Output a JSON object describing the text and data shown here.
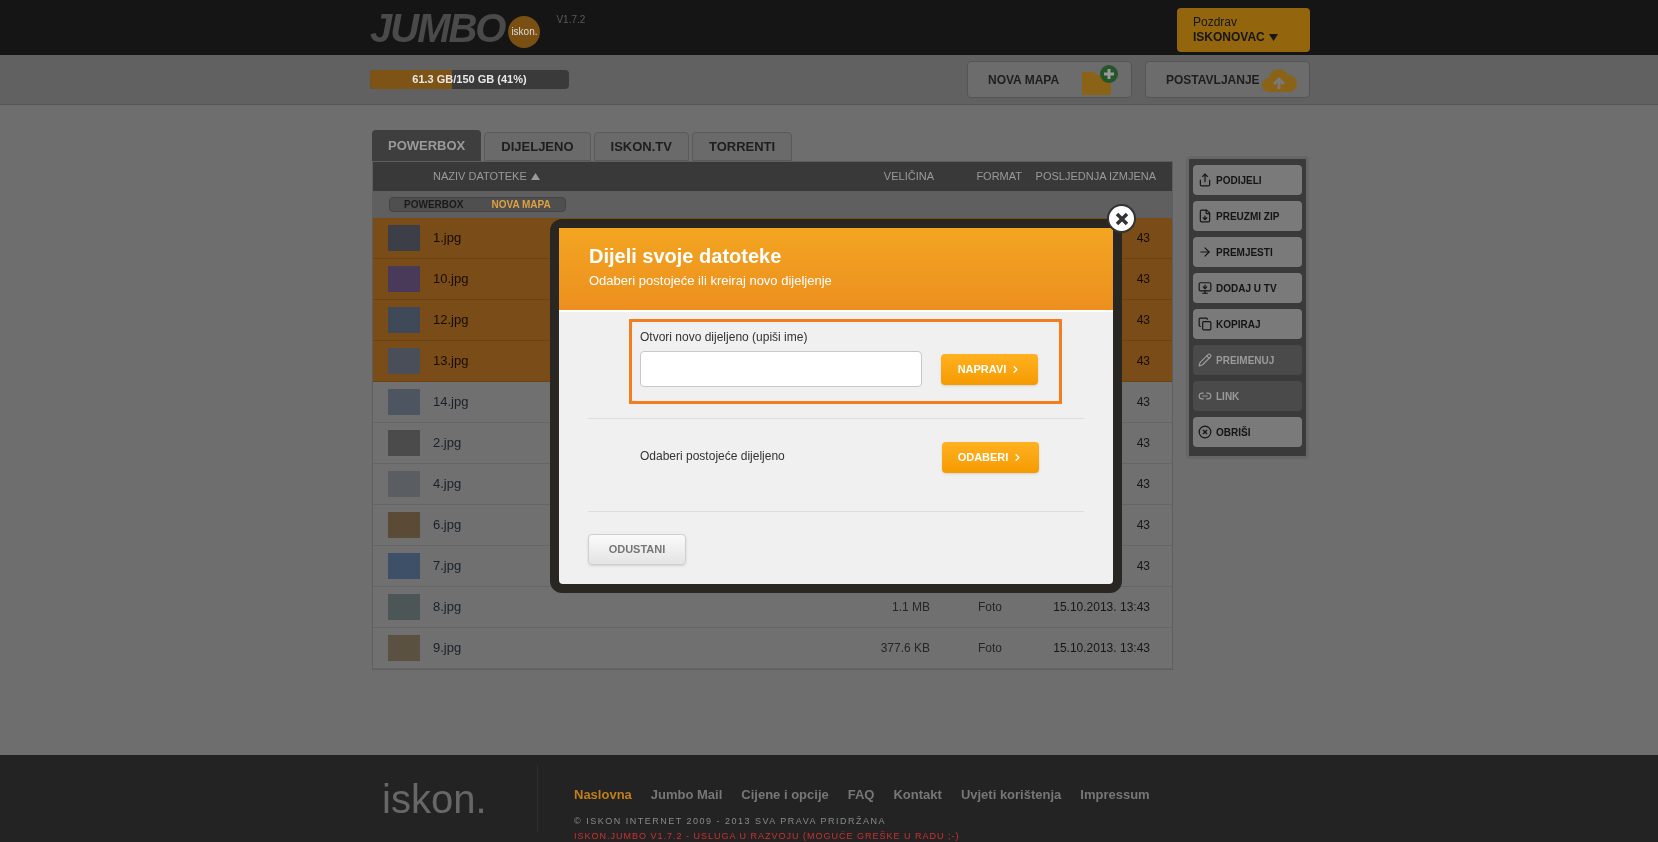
{
  "header": {
    "logo": "JUMBO",
    "logo_badge": "iskon.",
    "version": "V1.7.2",
    "greeting": {
      "label": "Pozdrav",
      "user": "ISKONOVAC"
    }
  },
  "toolbar": {
    "storage": {
      "level": 0.41,
      "reading": "61.3 GB/150 GB (41%)"
    },
    "buttons": [
      {
        "label": "NOVA MAPA",
        "kind": "folder"
      },
      {
        "label": "POSTAVLJANJE",
        "kind": "upload"
      }
    ]
  },
  "tabs": [
    {
      "label": "POWERBOX",
      "selected": true
    },
    {
      "label": "DIJELJENO",
      "selected": false
    },
    {
      "label": "ISKON.TV",
      "selected": false
    },
    {
      "label": "TORRENTI",
      "selected": false
    }
  ],
  "table": {
    "columns": [
      "NAZIV DATOTEKE",
      "VELIČINA",
      "FORMAT",
      "POSLJEDNJA IZMJENA"
    ],
    "breadcrumb": [
      {
        "label": "POWERBOX",
        "selected": false
      },
      {
        "label": "NOVA MAPA",
        "selected": true
      }
    ],
    "rows": [
      {
        "name": "1.jpg",
        "selected": true,
        "modified": "43"
      },
      {
        "name": "10.jpg",
        "selected": true,
        "modified": "43"
      },
      {
        "name": "12.jpg",
        "selected": true,
        "modified": "43"
      },
      {
        "name": "13.jpg",
        "selected": true,
        "modified": "43"
      },
      {
        "name": "14.jpg",
        "selected": false,
        "modified": "43"
      },
      {
        "name": "2.jpg",
        "selected": false,
        "modified": "43"
      },
      {
        "name": "4.jpg",
        "selected": false,
        "modified": "43"
      },
      {
        "name": "6.jpg",
        "selected": false,
        "modified": "43"
      },
      {
        "name": "7.jpg",
        "selected": false,
        "modified": "43"
      },
      {
        "name": "8.jpg",
        "selected": false,
        "size": "1.1 MB",
        "format": "Foto",
        "modified": "15.10.2013. 13:43"
      },
      {
        "name": "9.jpg",
        "selected": false,
        "size": "377.6 KB",
        "format": "Foto",
        "modified": "15.10.2013. 13:43"
      }
    ]
  },
  "actions": [
    {
      "label": "PODIJELI",
      "kind": "share",
      "disabled": false
    },
    {
      "label": "PREUZMI ZIP",
      "kind": "zip",
      "disabled": false
    },
    {
      "label": "PREMJESTI",
      "kind": "move",
      "disabled": false
    },
    {
      "label": "DODAJ U TV",
      "kind": "tv",
      "disabled": false
    },
    {
      "label": "KOPIRAJ",
      "kind": "copy",
      "disabled": false
    },
    {
      "label": "PREIMENUJ",
      "kind": "rename",
      "disabled": true
    },
    {
      "label": "LINK",
      "kind": "link",
      "disabled": true
    },
    {
      "label": "OBRIŠI",
      "kind": "delete",
      "disabled": false
    }
  ],
  "modal": {
    "title": "Dijeli svoje datoteke",
    "subtitle": "Odaberi postojeće ili kreiraj novo dijeljenje",
    "new_share": {
      "label": "Otvori novo dijeljeno (upiši ime)",
      "button": "NAPRAVI"
    },
    "existing": {
      "label": "Odaberi postojeće dijeljeno",
      "button": "ODABERI"
    },
    "cancel": "ODUSTANI"
  },
  "footer": {
    "logo": "iskon.",
    "links": [
      {
        "label": "Naslovna",
        "selected": true
      },
      {
        "label": "Jumbo Mail",
        "selected": false
      },
      {
        "label": "Cijene i opcije",
        "selected": false
      },
      {
        "label": "FAQ",
        "selected": false
      },
      {
        "label": "Kontakt",
        "selected": false
      },
      {
        "label": "Uvjeti korištenja",
        "selected": false
      },
      {
        "label": "Impressum",
        "selected": false
      }
    ],
    "copyright": "© ISKON INTERNET 2009 - 2013 SVA PRAVA PRIDRŽANA",
    "notice": "ISKON.JUMBO V1.7.2 - USLUGA U RAZVOJU (MOGUĆE GREŠKE U RADU ;-)"
  }
}
